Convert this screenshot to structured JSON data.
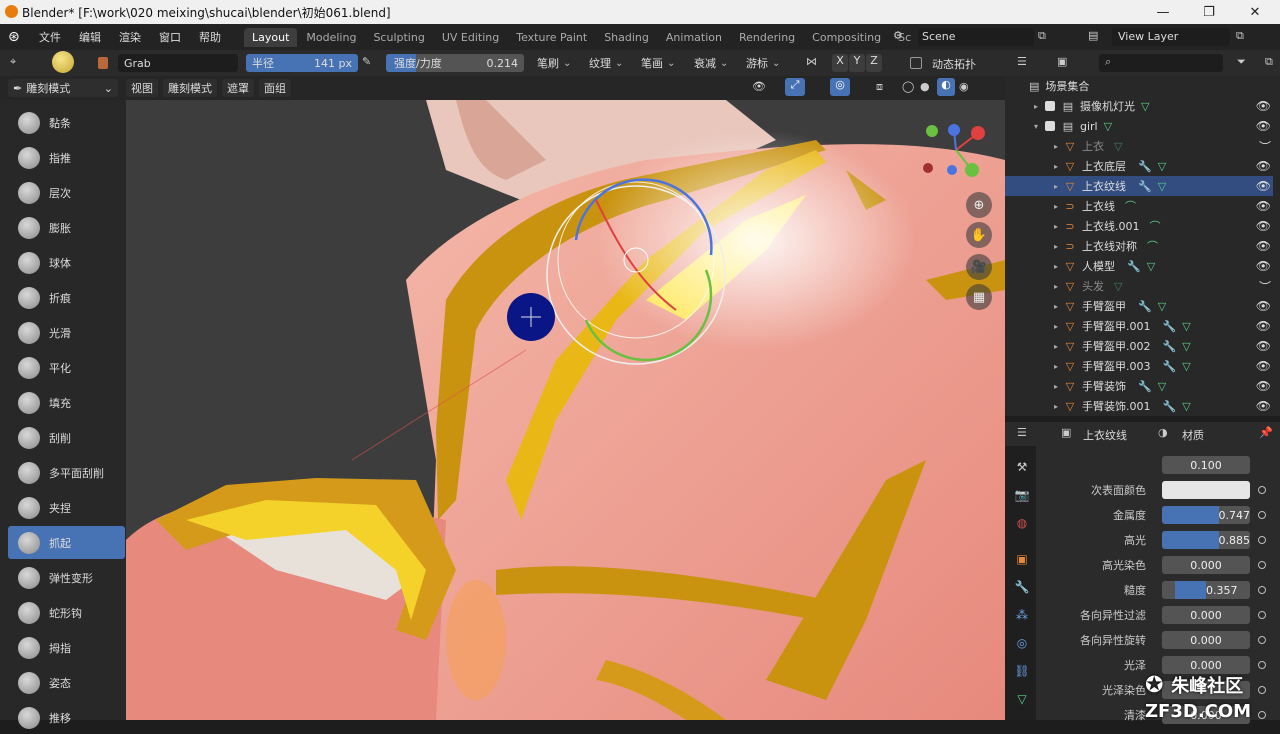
{
  "window": {
    "title": "Blender* [F:\\work\\020 meixing\\shucai\\blender\\初始061.blend]",
    "minimize": "—",
    "maximize": "❐",
    "close": "✕"
  },
  "menu": {
    "items": [
      "文件",
      "编辑",
      "渲染",
      "窗口",
      "帮助"
    ]
  },
  "workspaces": {
    "tabs": [
      "Layout",
      "Modeling",
      "Sculpting",
      "UV Editing",
      "Texture Paint",
      "Shading",
      "Animation",
      "Rendering",
      "Compositing",
      "Sc"
    ],
    "active": "Layout"
  },
  "scene": {
    "label": "Scene",
    "view_layer": "View Layer"
  },
  "tool_header": {
    "brush_name": "Grab",
    "radius_label": "半径",
    "radius_value": "141 px",
    "strength_label": "强度/力度",
    "strength_value": "0.214",
    "strength_fraction": 0.214,
    "brush_dd": "笔刷",
    "texture_dd": "纹理",
    "stroke_dd": "笔画",
    "falloff_dd": "衰减",
    "cursor_dd": "游标",
    "axes": [
      "X",
      "Y",
      "Z"
    ],
    "dyntopo": "动态拓扑"
  },
  "header2": {
    "mode": "雕刻模式",
    "view": "视图",
    "sculpt": "雕刻模式",
    "mask": "遮罩",
    "face_sets": "面组"
  },
  "tools": [
    {
      "label": "黏条",
      "icon": "draw-sharp-icon"
    },
    {
      "label": "指推",
      "icon": "nudge-icon"
    },
    {
      "label": "层次",
      "icon": "layer-icon"
    },
    {
      "label": "膨胀",
      "icon": "inflate-icon"
    },
    {
      "label": "球体",
      "icon": "blob-icon"
    },
    {
      "label": "折痕",
      "icon": "crease-icon"
    },
    {
      "label": "光滑",
      "icon": "smooth-icon"
    },
    {
      "label": "平化",
      "icon": "flatten-icon"
    },
    {
      "label": "填充",
      "icon": "fill-icon"
    },
    {
      "label": "刮削",
      "icon": "scrape-icon"
    },
    {
      "label": "多平面刮削",
      "icon": "multiplane-scrape-icon"
    },
    {
      "label": "夹捏",
      "icon": "pinch-icon"
    },
    {
      "label": "抓起",
      "icon": "grab-icon",
      "active": true
    },
    {
      "label": "弹性变形",
      "icon": "elastic-deform-icon"
    },
    {
      "label": "蛇形钩",
      "icon": "snake-hook-icon"
    },
    {
      "label": "拇指",
      "icon": "thumb-icon"
    },
    {
      "label": "姿态",
      "icon": "pose-icon"
    },
    {
      "label": "推移",
      "icon": "nudge2-icon"
    }
  ],
  "outliner": {
    "root": "场景集合",
    "rows": [
      {
        "name": "摄像机灯光",
        "kind": "collection",
        "level": 1
      },
      {
        "name": "girl",
        "kind": "collection",
        "level": 1
      },
      {
        "name": "上衣",
        "kind": "mesh",
        "level": 2,
        "dim": true
      },
      {
        "name": "上衣底层",
        "kind": "mesh",
        "level": 2
      },
      {
        "name": "上衣纹线",
        "kind": "mesh",
        "level": 2,
        "selected": true
      },
      {
        "name": "上衣线",
        "kind": "curve",
        "level": 2
      },
      {
        "name": "上衣线.001",
        "kind": "curve",
        "level": 2
      },
      {
        "name": "上衣线对称",
        "kind": "curve",
        "level": 2
      },
      {
        "name": "人模型",
        "kind": "mesh",
        "level": 2
      },
      {
        "name": "头发",
        "kind": "mesh",
        "level": 2,
        "dim": true
      },
      {
        "name": "手臂盔甲",
        "kind": "mesh",
        "level": 2
      },
      {
        "name": "手臂盔甲.001",
        "kind": "mesh",
        "level": 2
      },
      {
        "name": "手臂盔甲.002",
        "kind": "mesh",
        "level": 2
      },
      {
        "name": "手臂盔甲.003",
        "kind": "mesh",
        "level": 2
      },
      {
        "name": "手臂装饰",
        "kind": "mesh",
        "level": 2
      },
      {
        "name": "手臂装饰.001",
        "kind": "mesh",
        "level": 2
      }
    ]
  },
  "properties": {
    "object": "上衣纹线",
    "tab": "材质",
    "rows": [
      {
        "label": "",
        "value": "0.100",
        "kind": "number"
      },
      {
        "label": "次表面颜色",
        "value": "",
        "kind": "color",
        "color": "#e6e6e6"
      },
      {
        "label": "金属度",
        "value": "0.747",
        "kind": "slider",
        "fraction": 0.747
      },
      {
        "label": "高光",
        "value": "0.885",
        "kind": "slider",
        "fraction": 0.885
      },
      {
        "label": "高光染色",
        "value": "0.000",
        "kind": "slider",
        "fraction": 0
      },
      {
        "label": "糙度",
        "value": "0.357",
        "kind": "slider",
        "fraction": 0.357
      },
      {
        "label": "各向异性过滤",
        "value": "0.000",
        "kind": "slider",
        "fraction": 0
      },
      {
        "label": "各向异性旋转",
        "value": "0.000",
        "kind": "slider",
        "fraction": 0
      },
      {
        "label": "光泽",
        "value": "0.000",
        "kind": "slider",
        "fraction": 0
      },
      {
        "label": "光泽染色",
        "value": "",
        "kind": "slider",
        "fraction": 0
      },
      {
        "label": "清漆",
        "value": "0.000",
        "kind": "slider",
        "fraction": 0
      }
    ]
  },
  "watermark": "朱峰社区\nZF3D.COM"
}
